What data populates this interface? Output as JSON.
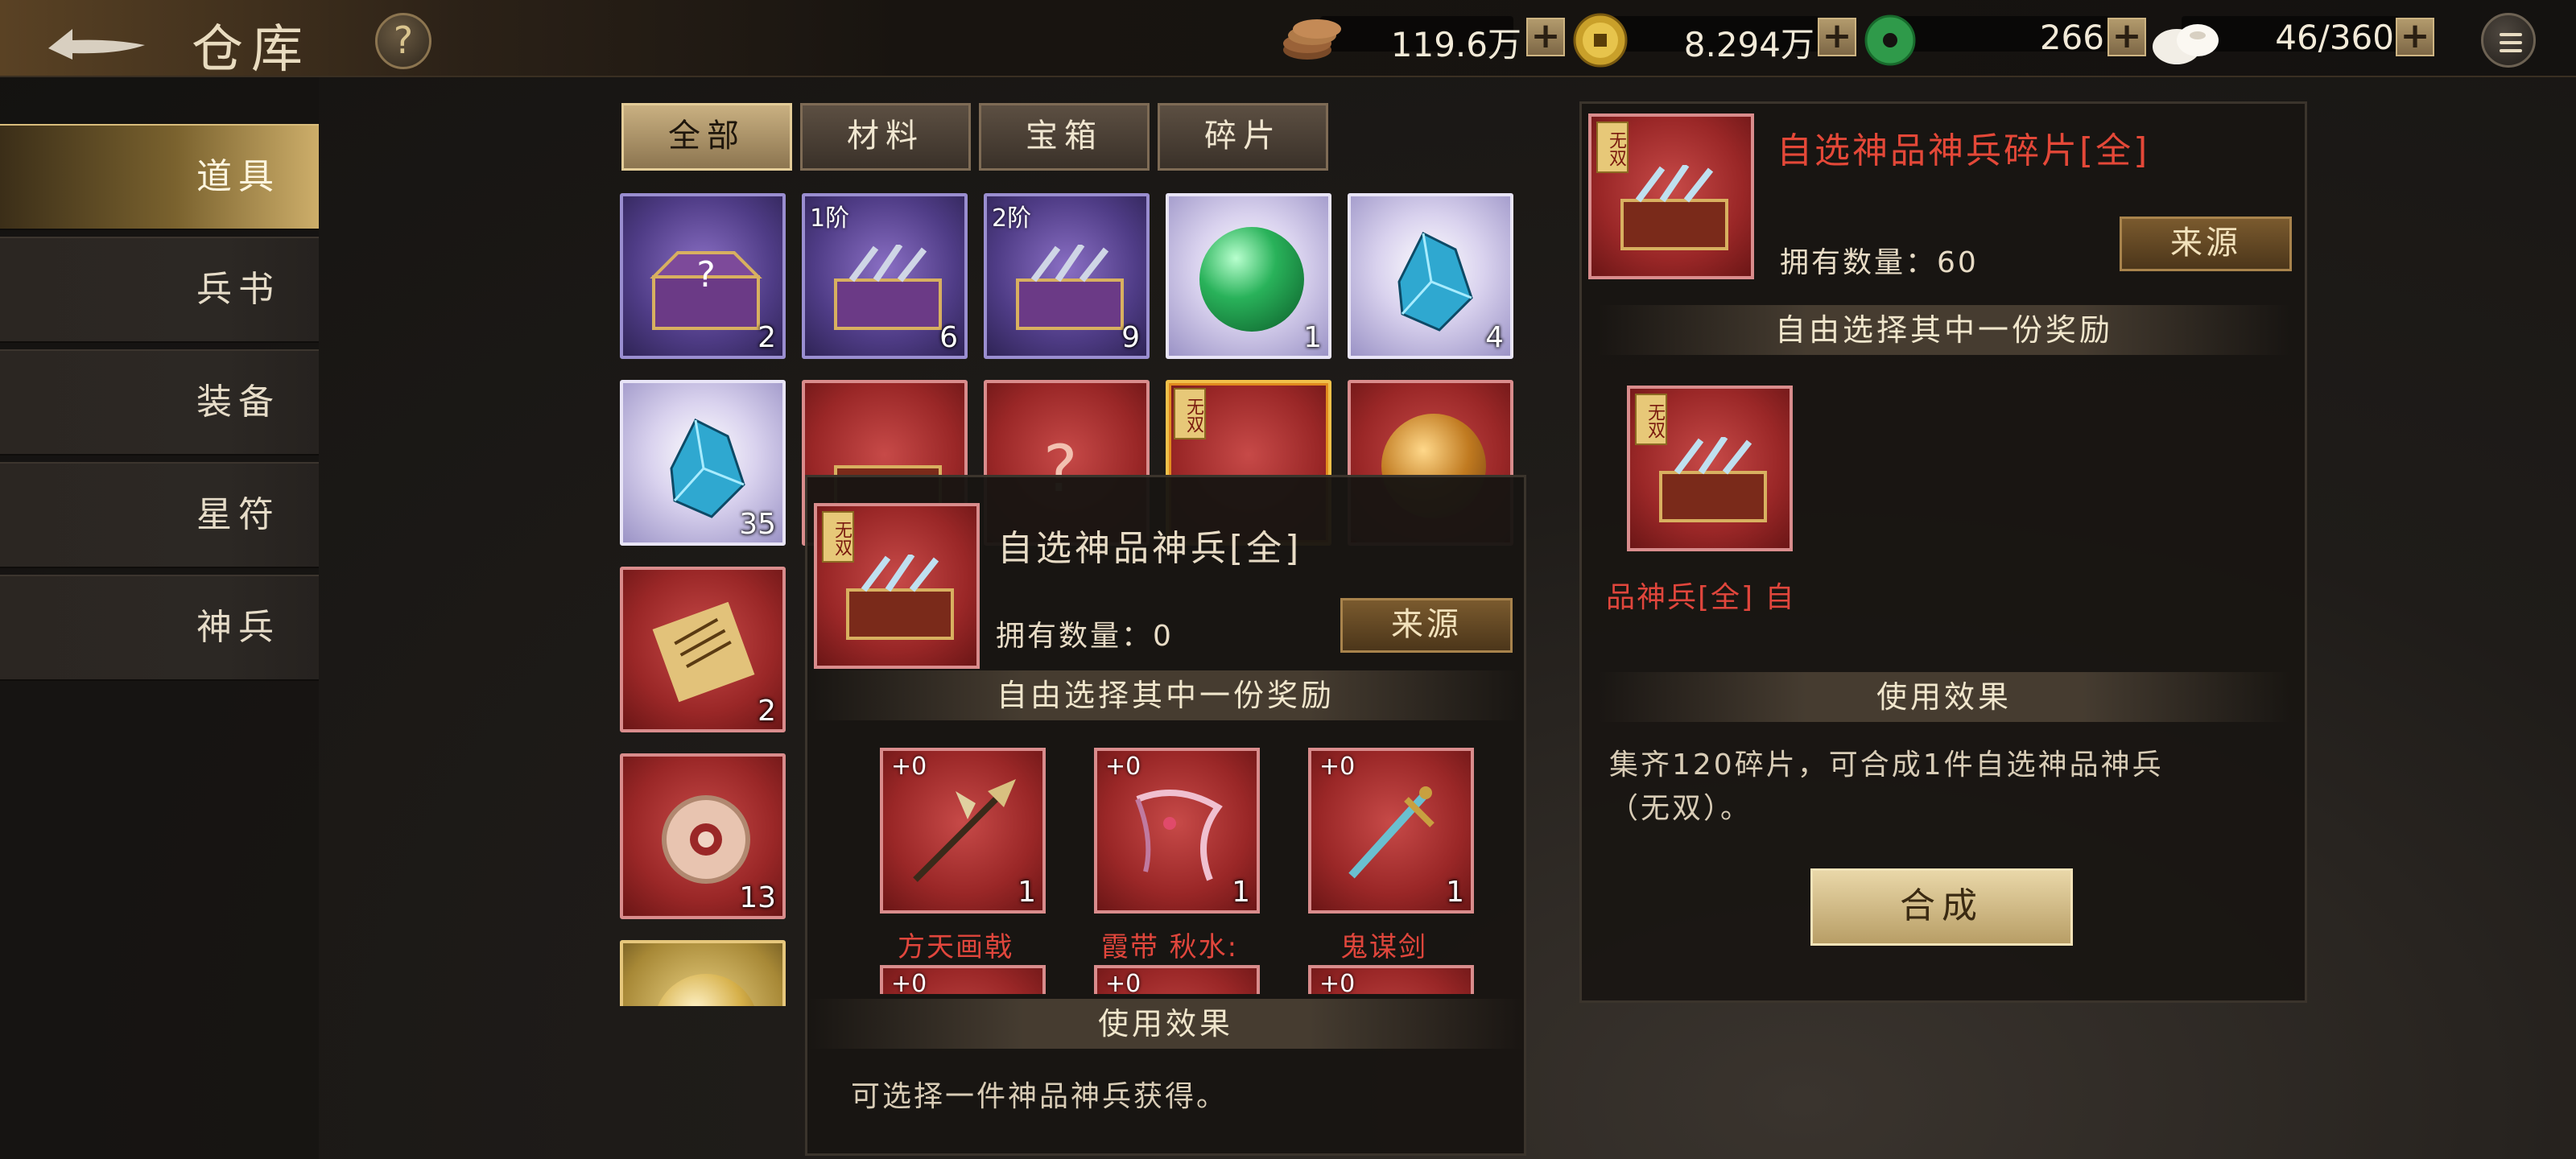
{
  "header": {
    "title": "仓库",
    "help_label": "?",
    "resources": [
      {
        "icon": "copper-coin-stack-icon",
        "value": "119.6万"
      },
      {
        "icon": "gold-coin-icon",
        "value": "8.294万"
      },
      {
        "icon": "jade-coin-icon",
        "value": "266"
      },
      {
        "icon": "steamed-bun-icon",
        "value": "46/360"
      }
    ],
    "plus_label": "+"
  },
  "sidebar": {
    "items": [
      {
        "label": "道具",
        "active": true
      },
      {
        "label": "兵书",
        "active": false
      },
      {
        "label": "装备",
        "active": false
      },
      {
        "label": "星符",
        "active": false
      },
      {
        "label": "神兵",
        "active": false
      }
    ]
  },
  "tabs": [
    {
      "label": "全部",
      "active": true
    },
    {
      "label": "材料",
      "active": false
    },
    {
      "label": "宝箱",
      "active": false
    },
    {
      "label": "碎片",
      "active": false
    }
  ],
  "grid": {
    "items": [
      {
        "icon": "mystery-chest-icon",
        "tier": "",
        "count": "2"
      },
      {
        "icon": "weapon-chest-icon",
        "tier": "1阶",
        "count": "6"
      },
      {
        "icon": "weapon-chest-icon",
        "tier": "2阶",
        "count": "9"
      },
      {
        "icon": "green-orb-icon",
        "tier": "",
        "count": "1"
      },
      {
        "icon": "blue-crystal-icon",
        "tier": "",
        "count": "4"
      },
      {
        "icon": "blue-crystal-icon",
        "tier": "",
        "count": "35"
      },
      {
        "icon": "scroll-icon",
        "tier": "",
        "count": "2"
      },
      {
        "icon": "jade-ring-icon",
        "tier": "",
        "count": "13"
      },
      {
        "icon": "golden-orb-icon",
        "tier": "",
        "count": ""
      }
    ]
  },
  "popup": {
    "badge": "无双",
    "title": "自选神品神兵[全]",
    "owned_label": "拥有数量：",
    "owned_value": "0",
    "source_label": "来源",
    "choose_header": "自由选择其中一份奖励",
    "rewards": [
      {
        "name": "方天画戟",
        "plus": "+0",
        "count": "1",
        "icon": "halberd-icon"
      },
      {
        "name": "霞带 秋水:",
        "plus": "+0",
        "count": "1",
        "icon": "ribbon-icon"
      },
      {
        "name": "鬼谋剑",
        "plus": "+0",
        "count": "1",
        "icon": "sword-icon"
      },
      {
        "name": "",
        "plus": "+0",
        "count": "",
        "icon": "feather-fan-icon"
      },
      {
        "name": "",
        "plus": "+0",
        "count": "",
        "icon": "dragon-blade-icon"
      },
      {
        "name": "",
        "plus": "+0",
        "count": "",
        "icon": "spear-icon"
      }
    ],
    "effect_header": "使用效果",
    "effect_text": "可选择一件神品神兵获得。"
  },
  "detail": {
    "badge": "无双",
    "title": "自选神品神兵碎片[全]",
    "owned_label": "拥有数量：",
    "owned_value": "60",
    "source_label": "来源",
    "choose_header": "自由选择其中一份奖励",
    "reward_marquee": "品神兵[全] 自",
    "effect_header": "使用效果",
    "effect_text_1": "集齐120碎片，可合成1件自选神品神兵",
    "effect_text_2": "（无双）。",
    "compose_label": "合成"
  },
  "colors": {
    "accent_gold": "#c9b081",
    "item_red": "#9a2727",
    "name_red": "#e0463c"
  }
}
